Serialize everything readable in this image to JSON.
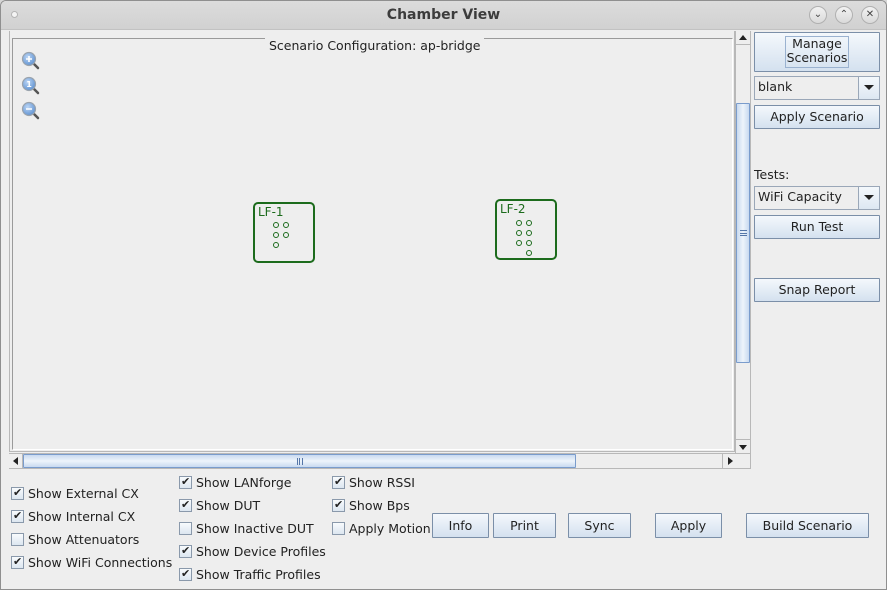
{
  "window": {
    "title": "Chamber View",
    "controls": [
      "minimize",
      "maximize",
      "close"
    ]
  },
  "canvas": {
    "legend": "Scenario Configuration:  ap-bridge",
    "zoom_tools": [
      {
        "name": "zoom-in",
        "glyph": "+"
      },
      {
        "name": "zoom-reset",
        "glyph": "1"
      },
      {
        "name": "zoom-out",
        "glyph": "−"
      }
    ],
    "nodes": [
      {
        "label": "LF-1",
        "ports": 5
      },
      {
        "label": "LF-2",
        "ports": 7
      }
    ],
    "color": "#1c6b1c"
  },
  "side_panel": {
    "manage_scenarios": "Manage Scenarios",
    "manage_line1": "Manage",
    "manage_line2": "Scenarios",
    "scenario_select": "blank",
    "apply_scenario": "Apply Scenario",
    "tests_label": "Tests:",
    "tests_select": "WiFi Capacity",
    "run_test": "Run Test",
    "snap_report": "Snap Report"
  },
  "options": {
    "col1": [
      {
        "label": "Show External CX",
        "checked": true
      },
      {
        "label": "Show Internal CX",
        "checked": true
      },
      {
        "label": "Show Attenuators",
        "checked": false
      },
      {
        "label": "Show WiFi Connections",
        "checked": true
      }
    ],
    "col2": [
      {
        "label": "Show LANforge",
        "checked": true
      },
      {
        "label": "Show DUT",
        "checked": true
      },
      {
        "label": "Show Inactive DUT",
        "checked": false
      },
      {
        "label": "Show Device Profiles",
        "checked": true
      },
      {
        "label": "Show Traffic Profiles",
        "checked": true
      }
    ],
    "col3": [
      {
        "label": "Show RSSI",
        "checked": true
      },
      {
        "label": "Show Bps",
        "checked": true
      },
      {
        "label": "Apply Motion",
        "checked": false
      }
    ]
  },
  "actions": {
    "info": "Info",
    "print": "Print",
    "sync": "Sync",
    "apply": "Apply",
    "build_scenario": "Build Scenario"
  }
}
